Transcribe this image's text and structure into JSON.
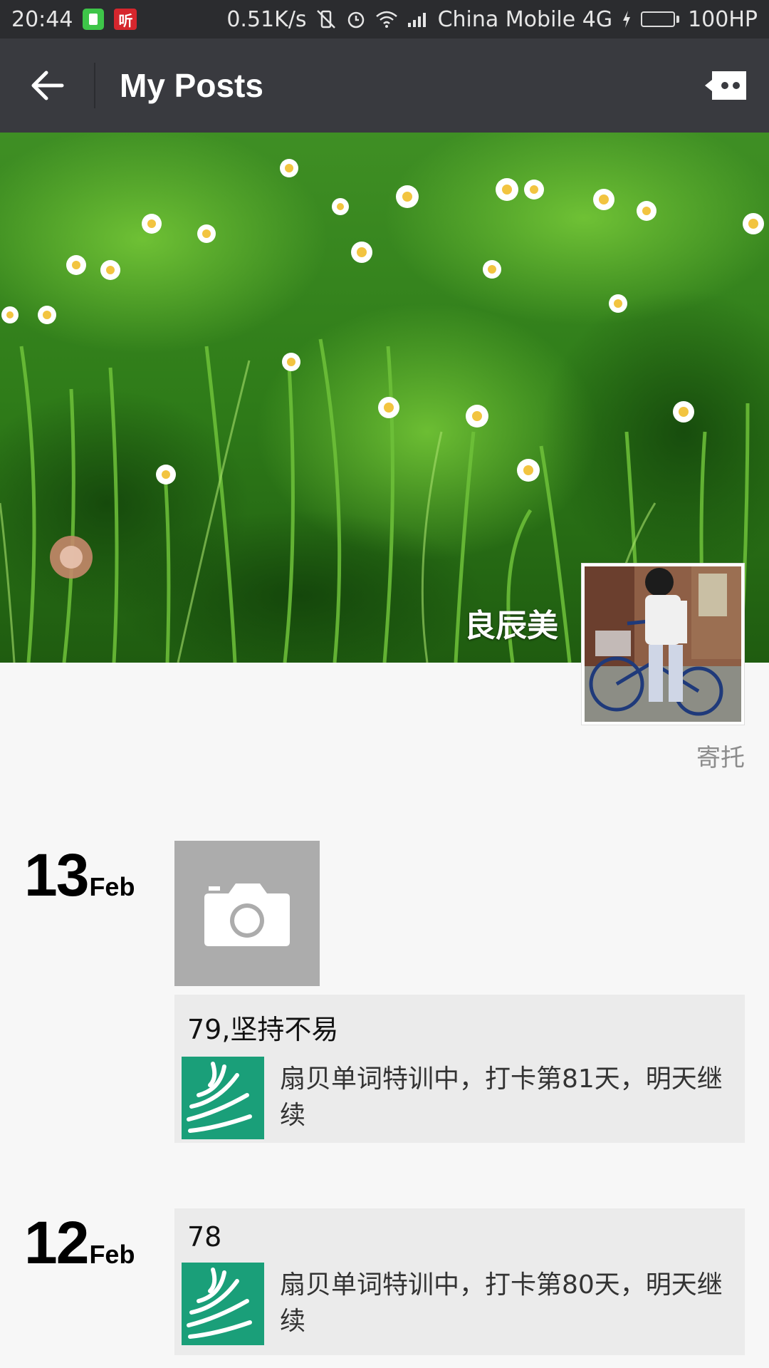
{
  "status_bar": {
    "time": "20:44",
    "app_icon_red_text": "听",
    "speed": "0.51K/s",
    "carrier": "China Mobile 4G",
    "battery": "100HP",
    "battery_level": 100
  },
  "title_bar": {
    "title": "My Posts",
    "back_icon": "arrow-left-icon",
    "more_icon": "more-dots-icon"
  },
  "profile": {
    "nickname": "良辰美",
    "signature": "寄托"
  },
  "posts": [
    {
      "day": "13",
      "month": "Feb",
      "has_photo_placeholder": true,
      "text": "79,坚持不易",
      "link_text": "扇贝单词特训中，打卡第81天，明天继续"
    },
    {
      "day": "12",
      "month": "Feb",
      "has_photo_placeholder": false,
      "text": "78",
      "link_text": "扇贝单词特训中，打卡第80天，明天继续"
    }
  ],
  "colors": {
    "status_bar": "#2b2c2f",
    "title_bar": "#393a3f",
    "page_bg": "#f7f7f7",
    "card_bg": "#ebebeb",
    "link_thumb": "#1a9f79"
  }
}
